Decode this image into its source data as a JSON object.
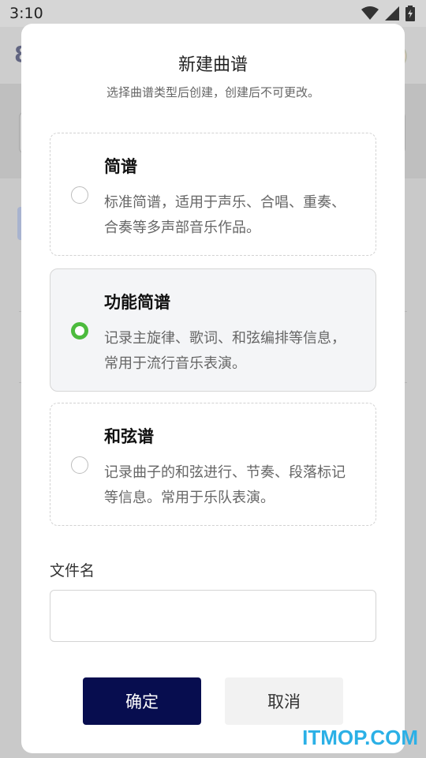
{
  "status_bar": {
    "time": "3:10",
    "icons": [
      "wifi-icon",
      "signal-icon",
      "battery-icon"
    ]
  },
  "dialog": {
    "title": "新建曲谱",
    "subtitle": "选择曲谱类型后创建，创建后不可更改。",
    "options": [
      {
        "title": "简谱",
        "desc": "标准简谱，适用于声乐、合唱、重奏、合奏等多声部音乐作品。",
        "selected": false
      },
      {
        "title": "功能简谱",
        "desc": "记录主旋律、歌词、和弦编排等信息，常用于流行音乐表演。",
        "selected": true
      },
      {
        "title": "和弦谱",
        "desc": "记录曲子的和弦进行、节奏、段落标记等信息。常用于乐队表演。",
        "selected": false
      }
    ],
    "filename": {
      "label": "文件名",
      "value": "",
      "placeholder": ""
    },
    "buttons": {
      "confirm": "确定",
      "cancel": "取消"
    }
  },
  "watermark": "ITMOP.COM",
  "colors": {
    "confirm_bg": "#070d4f",
    "radio_selected": "#4cbb3d",
    "watermark": "#2bb0e6"
  }
}
